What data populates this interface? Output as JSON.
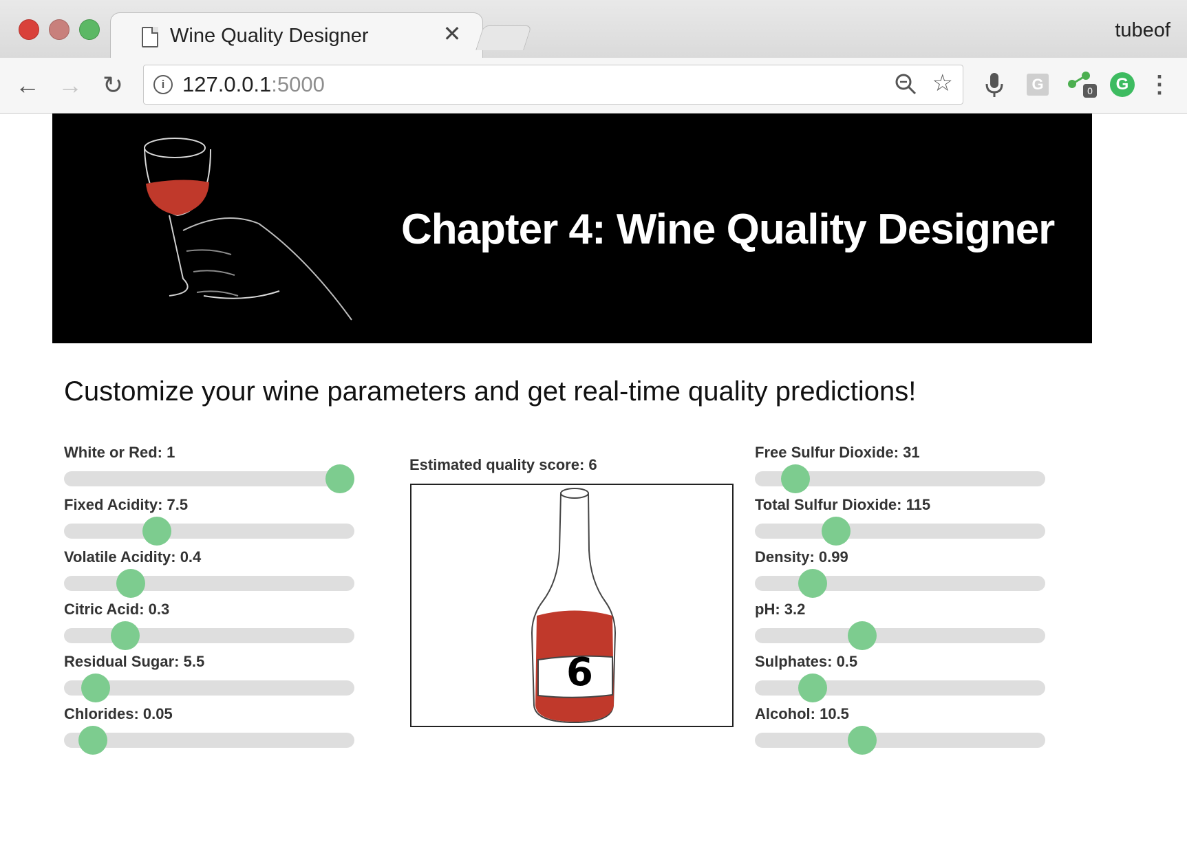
{
  "browser": {
    "tab_title": "Wine Quality Designer",
    "tab_close": "✕",
    "profile_name": "tubeof",
    "url_host": "127.0.0.1",
    "url_port": ":5000",
    "extension_badge": "0",
    "g_extension_label": "G",
    "grammarly_label": "G"
  },
  "banner": {
    "title": "Chapter 4: Wine Quality Designer"
  },
  "subtitle": "Customize your wine parameters and get real-time quality predictions!",
  "sliders_left": [
    {
      "label": "White or Red: 1",
      "level": 0.95
    },
    {
      "label": "Fixed Acidity: 7.5",
      "level": 0.32
    },
    {
      "label": "Volatile Acidity: 0.4",
      "level": 0.23
    },
    {
      "label": "Citric Acid: 0.3",
      "level": 0.21
    },
    {
      "label": "Residual Sugar: 5.5",
      "level": 0.11
    },
    {
      "label": "Chlorides: 0.05",
      "level": 0.1
    }
  ],
  "sliders_right": [
    {
      "label": "Free Sulfur Dioxide: 31",
      "level": 0.14
    },
    {
      "label": "Total Sulfur Dioxide: 115",
      "level": 0.28
    },
    {
      "label": "Density: 0.99",
      "level": 0.2
    },
    {
      "label": "pH: 3.2",
      "level": 0.37
    },
    {
      "label": "Sulphates: 0.5",
      "level": 0.2
    },
    {
      "label": "Alcohol: 10.5",
      "level": 0.37
    }
  ],
  "prediction": {
    "label": "Estimated quality score: 6",
    "bottle_number": "6"
  },
  "colors": {
    "wine_red": "#c0392b",
    "thumb_green": "#7dcc8f",
    "track_gray": "#dedede"
  }
}
